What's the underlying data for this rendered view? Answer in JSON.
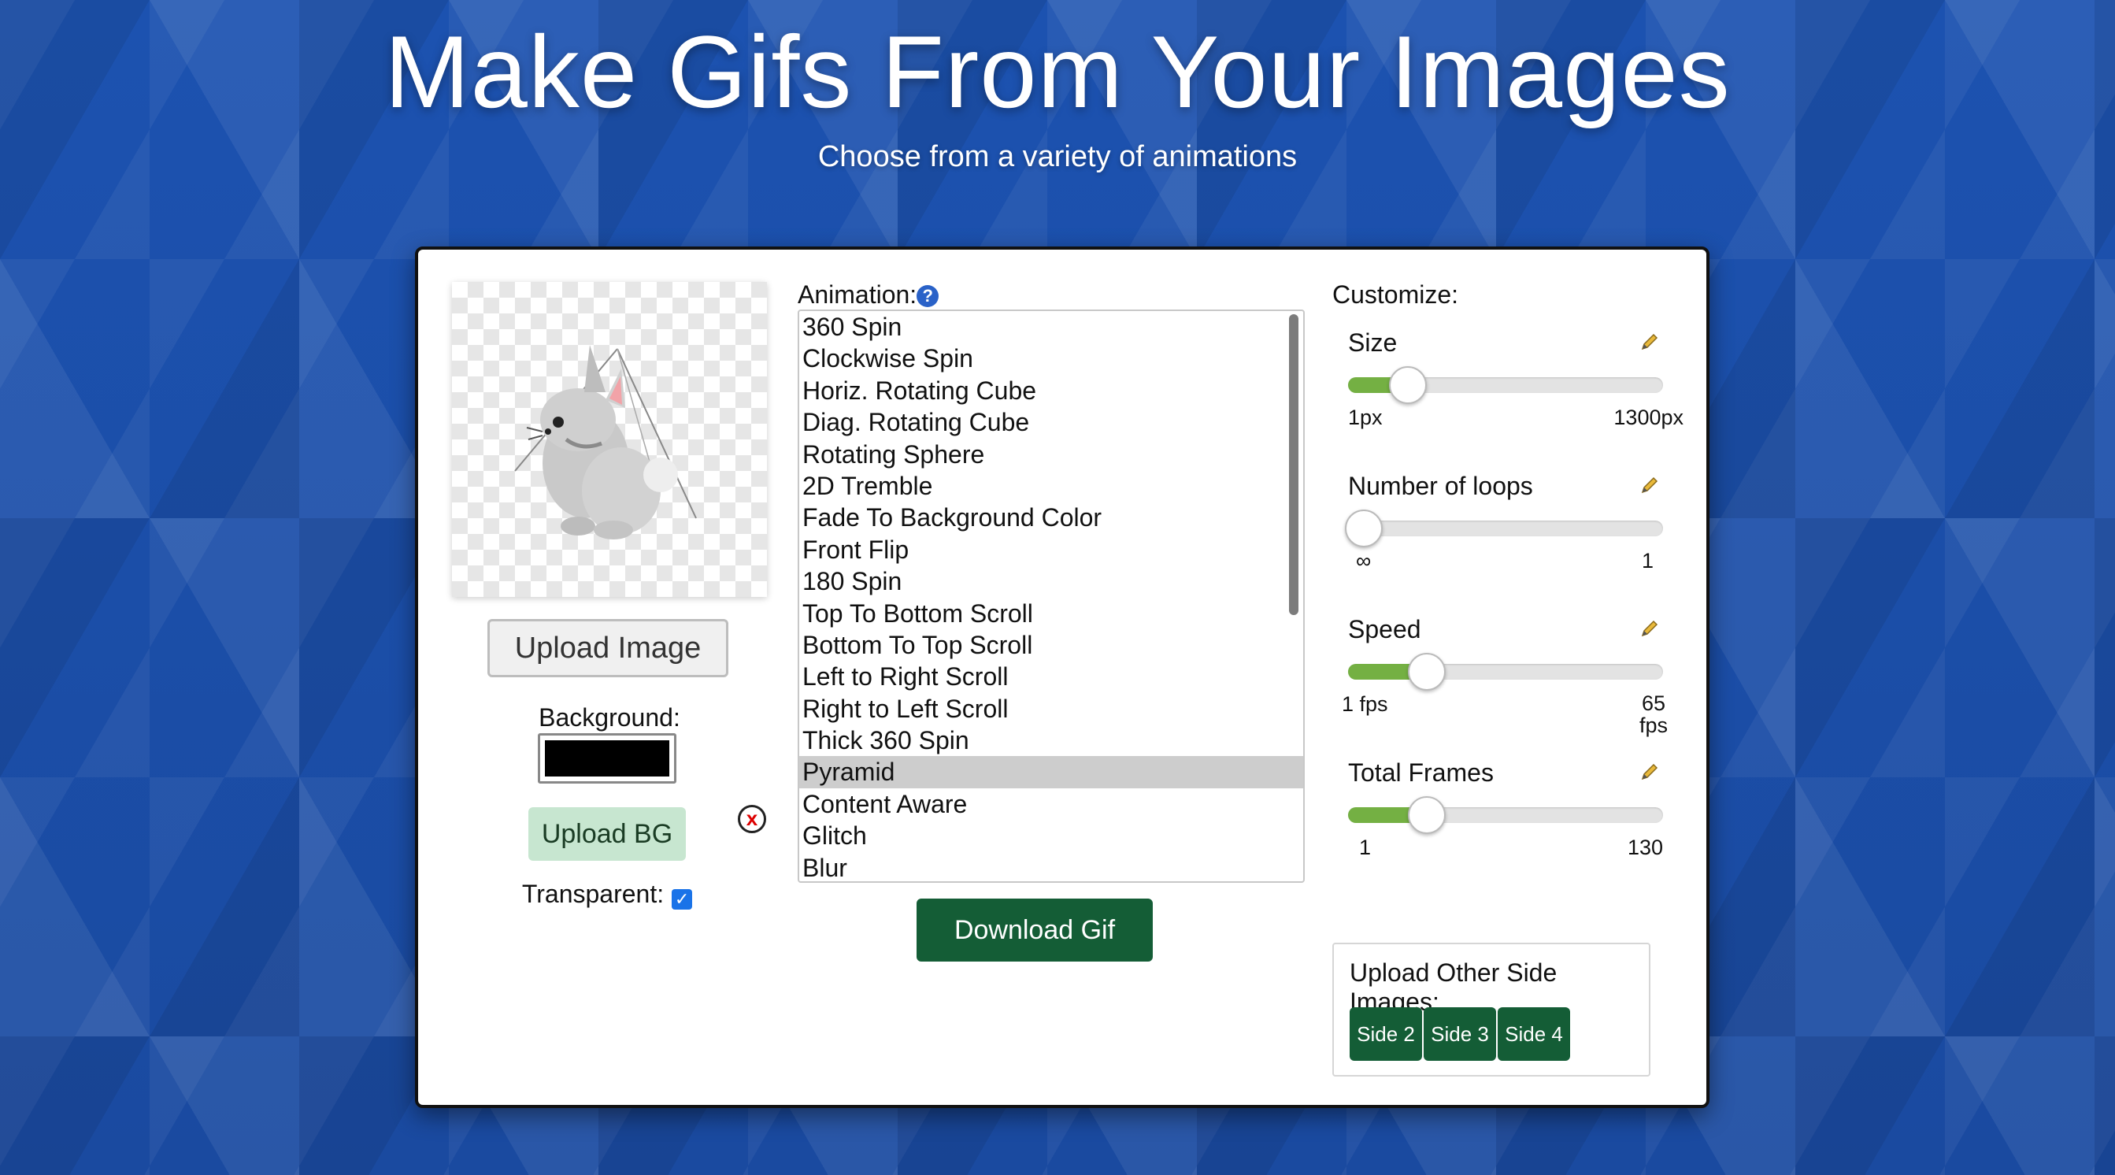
{
  "header": {
    "title": "Make Gifs From Your Images",
    "subtitle": "Choose from a variety of animations"
  },
  "left": {
    "upload_image_label": "Upload Image",
    "background_label": "Background:",
    "background_color": "#000000",
    "upload_bg_label": "Upload BG",
    "remove_bg_glyph": "x",
    "transparent_label": "Transparent:",
    "transparent_checked": true
  },
  "animation": {
    "label": "Animation:",
    "help_glyph": "?",
    "items": [
      "360 Spin",
      "Clockwise Spin",
      "Horiz. Rotating Cube",
      "Diag. Rotating Cube",
      "Rotating Sphere",
      "2D Tremble",
      "Fade To Background Color",
      "Front Flip",
      "180 Spin",
      "Top To Bottom Scroll",
      "Bottom To Top Scroll",
      "Left to Right Scroll",
      "Right to Left Scroll",
      "Thick 360 Spin",
      "Pyramid",
      "Content Aware",
      "Glitch",
      "Blur"
    ],
    "selected": "Pyramid",
    "download_label": "Download Gif"
  },
  "customize": {
    "label": "Customize:",
    "size": {
      "title": "Size",
      "min": "1px",
      "max": "1300px",
      "fraction": 0.19
    },
    "loops": {
      "title": "Number of loops",
      "min": "∞",
      "max": "1",
      "fraction": 0.05
    },
    "speed": {
      "title": "Speed",
      "min": "1 fps",
      "max_line1": "65",
      "max_line2": "fps",
      "fraction": 0.25
    },
    "frames": {
      "title": "Total Frames",
      "min": "1",
      "max": "130",
      "fraction": 0.25
    }
  },
  "other_sides": {
    "title": "Upload Other Side Images:",
    "buttons": [
      "Side 2",
      "Side 3",
      "Side 4"
    ]
  },
  "colors": {
    "accent_green": "#145d36",
    "slider_fill": "#74b043",
    "background_blue": "#1b4fa8"
  }
}
